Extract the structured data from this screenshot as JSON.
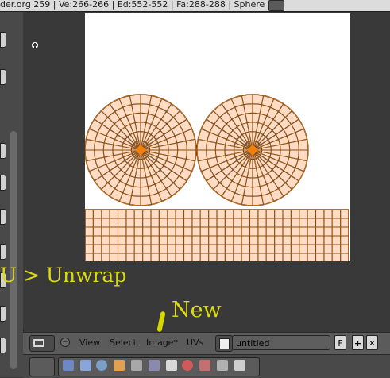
{
  "status_bar": {
    "info": "der.org 259 | Ve:266-266 | Ed:552-552 | Fa:288-288 | Sphere"
  },
  "overlay": {
    "unwrap_hint": "U > Unwrap",
    "new_hint": "New"
  },
  "uv_header": {
    "menus": [
      "View",
      "Select",
      "Image*",
      "UVs"
    ],
    "image_name": "untitled",
    "fake_user_label": "F"
  },
  "colors": {
    "uv_face_fill": "#ffdcc3",
    "uv_edge": "#f07f0d",
    "uv_edge_dark": "#2a1a0a",
    "overlay_text": "#dcdc10"
  },
  "icons": {
    "editor_type": "image-editor-icon",
    "image_browse": "image-browse-icon",
    "new_image": "plus-icon",
    "unlink": "close-icon"
  }
}
